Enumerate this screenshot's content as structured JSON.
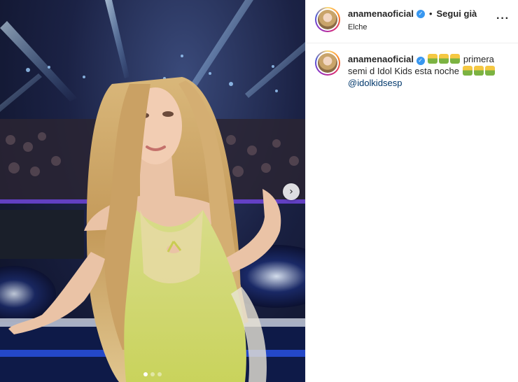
{
  "post": {
    "username": "anamenaoficial",
    "follow_label": "Segui già",
    "separator": "•",
    "location": "Elche",
    "more_icon": "more-horizontal-icon",
    "caption": {
      "username": "anamenaoficial",
      "text_part1": "primera semi d Idol Kids esta noche",
      "mention": "@idolkidsesp",
      "emoji_name": "person-emoji"
    },
    "carousel": {
      "total": 3,
      "active_index": 0,
      "next_icon": "chevron-right-icon"
    }
  },
  "colors": {
    "verified": "#3897f0",
    "mention": "#00376b",
    "text": "#262626",
    "border": "#efefef"
  }
}
